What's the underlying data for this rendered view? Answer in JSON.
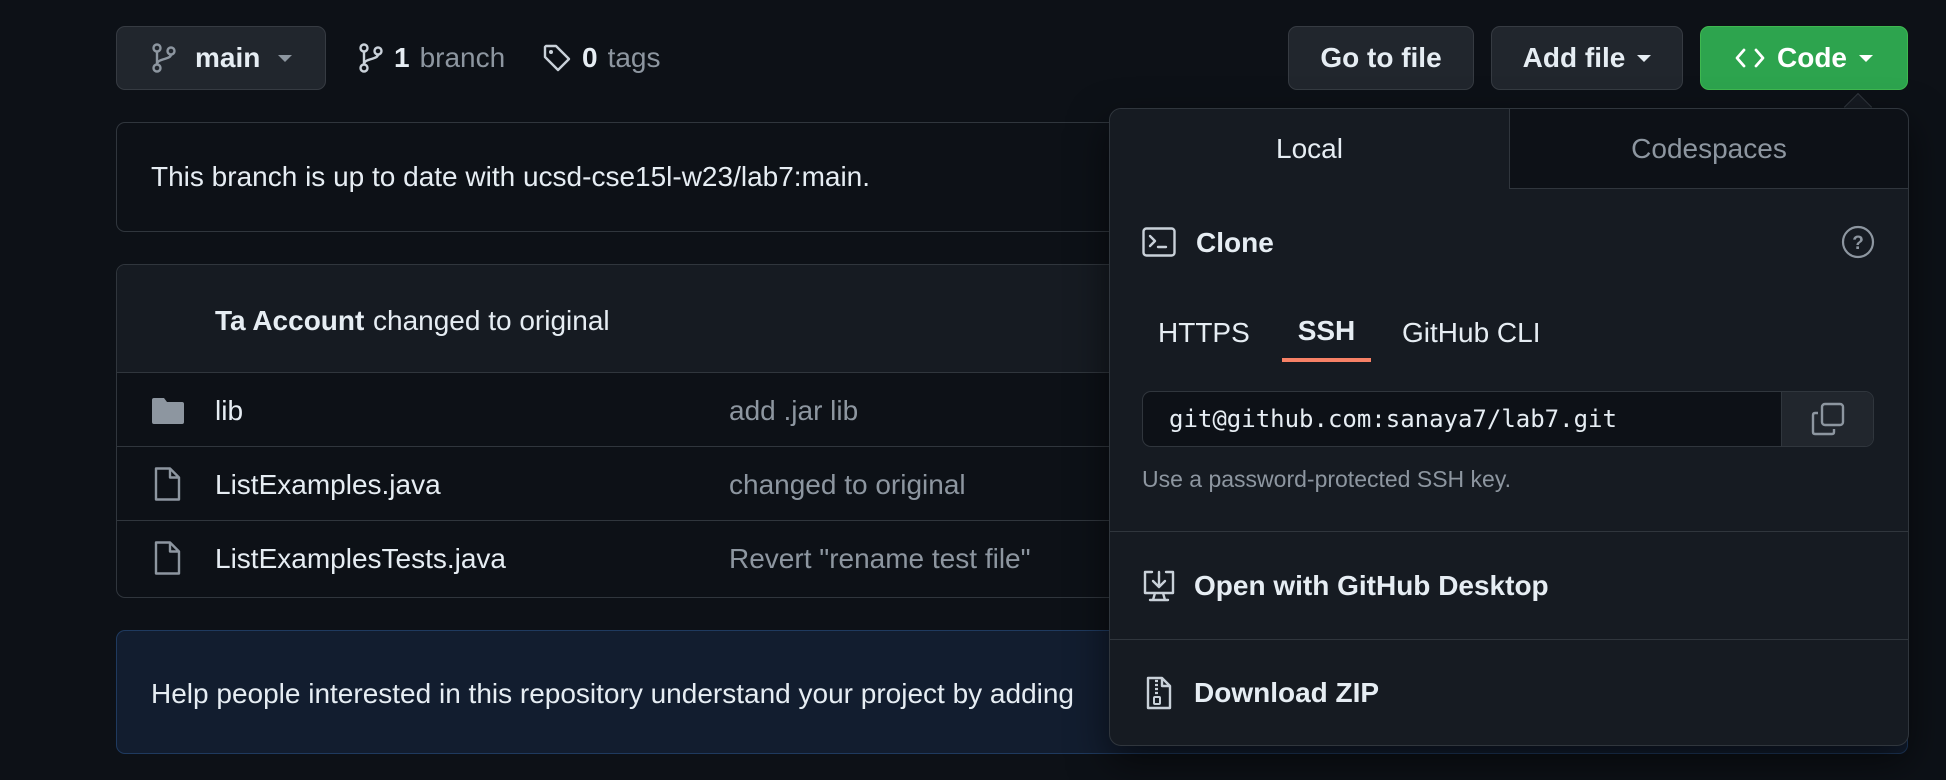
{
  "toolbar": {
    "branch_name": "main",
    "branch_count": "1",
    "branch_label": "branch",
    "tag_count": "0",
    "tag_label": "tags",
    "go_to_file": "Go to file",
    "add_file": "Add file",
    "code": "Code"
  },
  "status_banner": "This branch is up to date with ucsd-cse15l-w23/lab7:main.",
  "latest_commit": {
    "author": "Ta Account",
    "message": "changed to original"
  },
  "files": [
    {
      "name": "lib",
      "type": "folder",
      "commit": "add .jar lib"
    },
    {
      "name": "ListExamples.java",
      "type": "file",
      "commit": "changed to original"
    },
    {
      "name": "ListExamplesTests.java",
      "type": "file",
      "commit": "Revert \"rename test file\""
    }
  ],
  "readme_prompt": "Help people interested in this repository understand your project by adding",
  "code_dropdown": {
    "tabs": [
      "Local",
      "Codespaces"
    ],
    "active_tab": "Local",
    "clone_title": "Clone",
    "protocols": [
      "HTTPS",
      "SSH",
      "GitHub CLI"
    ],
    "active_protocol": "SSH",
    "clone_url": "git@github.com:sanaya7/lab7.git",
    "hint": "Use a password-protected SSH key.",
    "open_desktop": "Open with GitHub Desktop",
    "download_zip": "Download ZIP"
  },
  "colors": {
    "background": "#0d1117",
    "code_button": "#2da44e",
    "active_underline": "#f78166",
    "readme_banner": "#121d2f"
  }
}
